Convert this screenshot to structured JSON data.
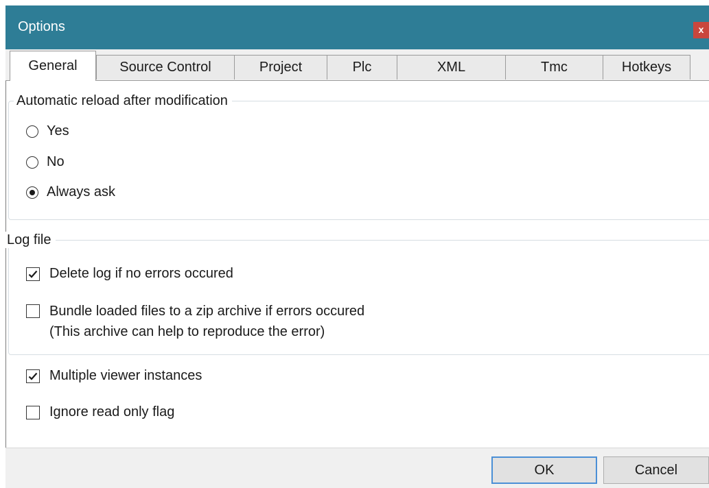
{
  "window": {
    "title": "Options",
    "close_label": "x"
  },
  "tabs": [
    {
      "label": "General",
      "active": true
    },
    {
      "label": "Source Control",
      "active": false
    },
    {
      "label": "Project",
      "active": false
    },
    {
      "label": "Plc",
      "active": false
    },
    {
      "label": "XML",
      "active": false
    },
    {
      "label": "Tmc",
      "active": false
    },
    {
      "label": "Hotkeys",
      "active": false
    }
  ],
  "reload_group": {
    "legend": "Automatic reload after modification",
    "options": [
      {
        "label": "Yes",
        "checked": false
      },
      {
        "label": "No",
        "checked": false
      },
      {
        "label": "Always ask",
        "checked": true
      }
    ]
  },
  "log_group": {
    "legend": "Log file",
    "delete_log": {
      "label": "Delete log if no errors occured",
      "checked": true
    },
    "bundle_files": {
      "label_line1": "Bundle loaded files to a zip archive if errors occured",
      "label_line2": "(This archive can help to reproduce the error)",
      "checked": false
    }
  },
  "misc": {
    "multiple_instances": {
      "label": "Multiple viewer instances",
      "checked": true
    },
    "ignore_readonly": {
      "label": "Ignore read only flag",
      "checked": false
    }
  },
  "footer": {
    "ok_label": "OK",
    "cancel_label": "Cancel"
  }
}
